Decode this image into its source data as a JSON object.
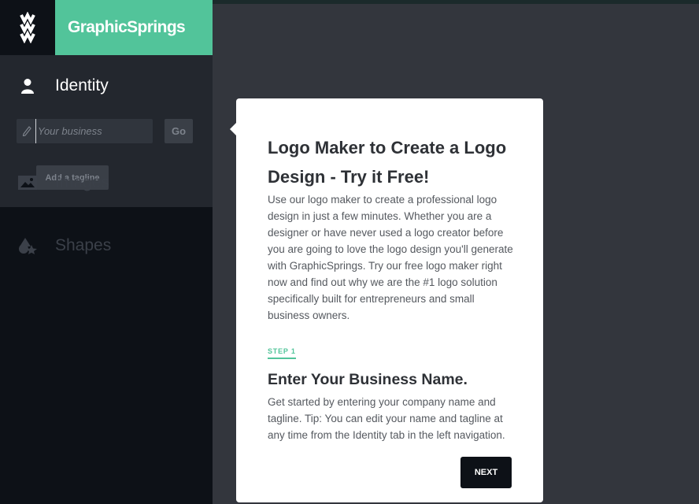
{
  "brand": {
    "name": "GraphicSprings"
  },
  "sidebar": {
    "identity": {
      "label": "Identity",
      "business_placeholder": "Your business",
      "business_value": "",
      "go_label": "Go",
      "tagline_button": "Add a tagline"
    },
    "items": [
      {
        "label": "Images",
        "icon": "image-icon"
      },
      {
        "label": "Shapes",
        "icon": "shapes-icon"
      }
    ]
  },
  "modal": {
    "title": "Logo Maker to Create a Logo Design - Try it Free!",
    "body": "Use our logo maker to create a professional logo design in just a few minutes. Whether you are a designer or have never used a logo creator before you are going to love the logo design you'll generate with GraphicSprings. Try our free logo maker right now and find out why we are the #1 logo solution specifically built for entrepreneurs and small business owners.",
    "step_label": "STEP 1",
    "step_title": "Enter Your Business Name.",
    "step_body": "Get started by entering your company name and tagline. Tip: You can edit your name and tagline at any time from the Identity tab in the left navigation.",
    "next_label": "NEXT"
  },
  "colors": {
    "accent": "#52c49a",
    "sidebar_bg": "#0d1117",
    "panel_bg": "#23272e",
    "canvas_bg": "#33363d"
  }
}
